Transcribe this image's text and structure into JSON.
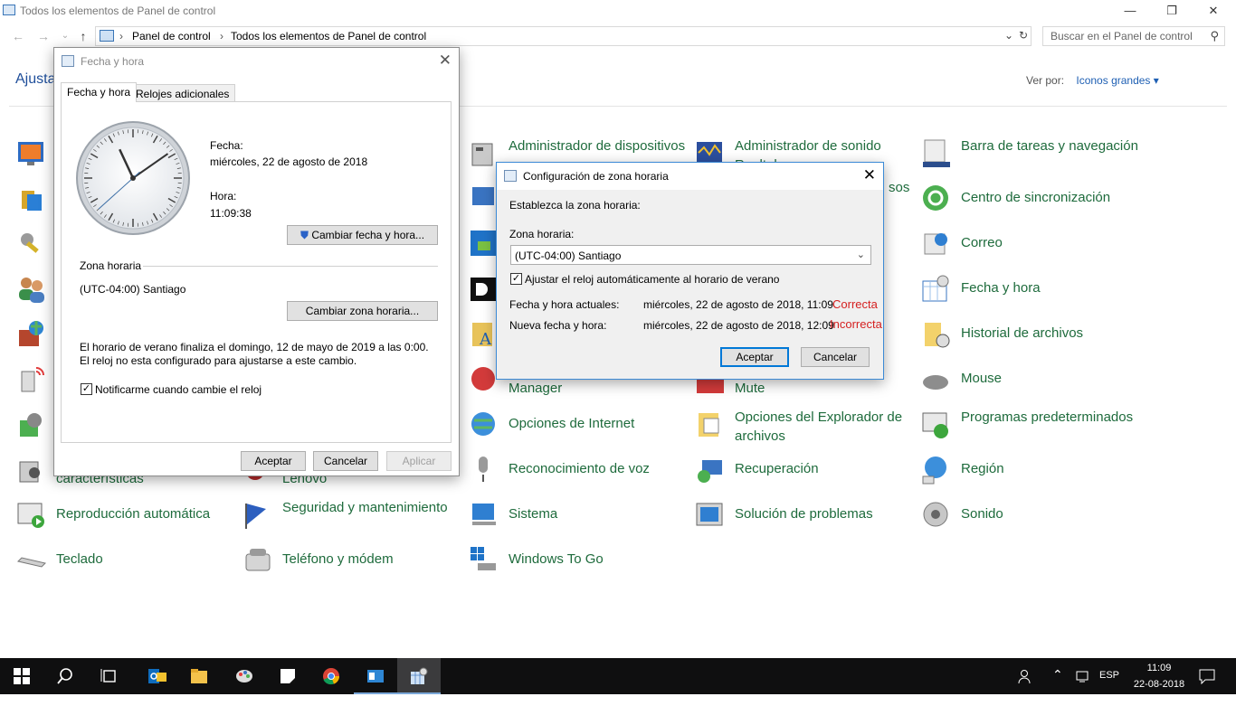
{
  "window": {
    "title": "Todos los elementos de Panel de control",
    "min_glyph": "—",
    "max_glyph": "❐",
    "close_glyph": "✕"
  },
  "address_bar": {
    "crumbs": [
      "Panel de control",
      "Todos los elementos de Panel de control"
    ],
    "search_placeholder": "Buscar en el Panel de control"
  },
  "heading": "Ajusta",
  "view_by": {
    "label": "Ver por:",
    "value": "Iconos grandes"
  },
  "cp_items": [
    {
      "label": "Administrador de dispositivos"
    },
    {
      "label": "Administrador de sonido Realtek"
    },
    {
      "label": "Barra de tareas y navegación"
    },
    {
      "label": "Centro de sincronización"
    },
    {
      "label": "Correo"
    },
    {
      "label": "Fecha y hora"
    },
    {
      "label": "Historial de archivos"
    },
    {
      "label": "Manager"
    },
    {
      "label": "Mute"
    },
    {
      "label": "Mouse"
    },
    {
      "label": "Opciones de Internet"
    },
    {
      "label": "Opciones del Explorador de archivos"
    },
    {
      "label": "Programas predeterminados"
    },
    {
      "label": "características"
    },
    {
      "label": "Lenovo"
    },
    {
      "label": "Reconocimiento de voz"
    },
    {
      "label": "Recuperación"
    },
    {
      "label": "Región"
    },
    {
      "label": "Reproducción automática"
    },
    {
      "label": "Seguridad y mantenimiento"
    },
    {
      "label": "Sistema"
    },
    {
      "label": "Solución de problemas"
    },
    {
      "label": "Sonido"
    },
    {
      "label": "Teclado"
    },
    {
      "label": "Teléfono y módem"
    },
    {
      "label": "Windows To Go"
    },
    {
      "label": "sos"
    }
  ],
  "dialog_datetime": {
    "title": "Fecha y hora",
    "tabs": [
      "Fecha y hora",
      "Relojes adicionales"
    ],
    "date_label": "Fecha:",
    "date_value": "miércoles, 22 de agosto de 2018",
    "time_label": "Hora:",
    "time_value": "11:09:38",
    "change_datetime_button": "Cambiar fecha y hora...",
    "timezone_section": "Zona horaria",
    "timezone_value": "(UTC-04:00) Santiago",
    "change_timezone_button": "Cambiar zona horaria...",
    "dst_notice": "El horario de verano finaliza el domingo, 12 de mayo de 2019 a las 0:00. El reloj no esta configurado para ajustarse a este cambio.",
    "notify_checkbox": "Notificarme cuando cambie el reloj",
    "notify_checked": true,
    "ok": "Aceptar",
    "cancel": "Cancelar",
    "apply": "Aplicar"
  },
  "dialog_timezone": {
    "title": "Configuración de zona horaria",
    "prompt": "Establezca la zona horaria:",
    "tz_label": "Zona horaria:",
    "tz_value": "(UTC-04:00) Santiago",
    "dst_checkbox": "Ajustar el reloj automáticamente al horario de verano",
    "dst_checked": true,
    "current_label": "Fecha y hora actuales:",
    "current_value": "miércoles, 22 de agosto de 2018, 11:09",
    "current_status": "Correcta",
    "new_label": "Nueva fecha y hora:",
    "new_value": "miércoles, 22 de agosto de 2018, 12:09",
    "new_status": "Incorrecta",
    "ok": "Aceptar",
    "cancel": "Cancelar"
  },
  "taskbar": {
    "lang": "ESP",
    "time": "11:09",
    "date": "22-08-2018"
  },
  "colors": {
    "link": "#1e6b3c",
    "accent": "#0078d7",
    "error": "#d52020"
  }
}
